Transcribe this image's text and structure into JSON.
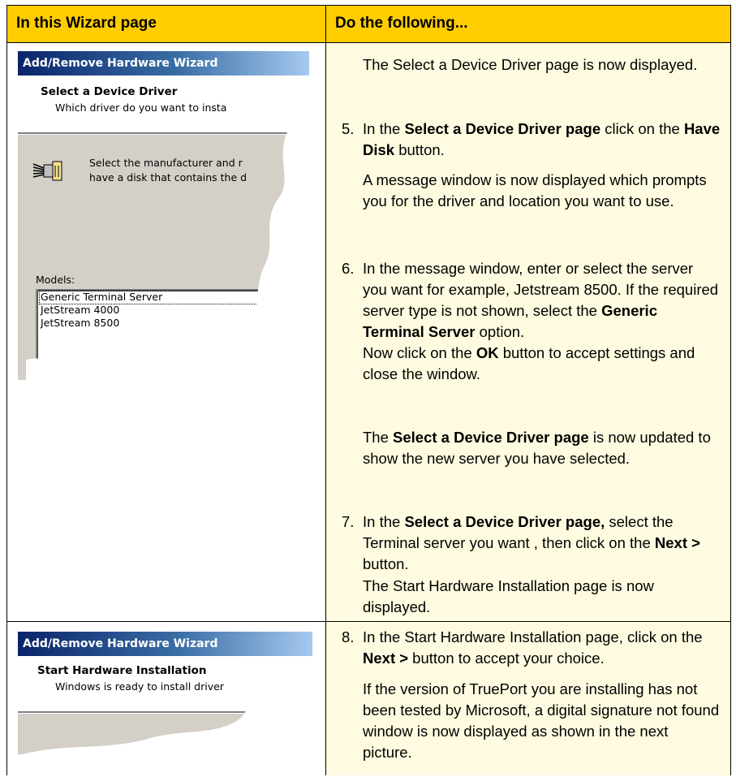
{
  "table": {
    "header_left": "In this Wizard page",
    "header_right": "Do the following...",
    "colors": {
      "header": "#ffcd00",
      "right_cell": "#fffbe0",
      "wizard_title_bar": "#0a246a",
      "dialog_grey": "#d4d0c8"
    }
  },
  "wizard1": {
    "title_bar": "Add/Remove Hardware Wizard",
    "heading": "Select a Device Driver",
    "subheading": "Which driver do you want to insta",
    "instruction_line1": "Select the manufacturer and r",
    "instruction_line2": "have a disk that contains the d",
    "icon": "serial-port-icon",
    "models_label": "Models:",
    "models": [
      "Generic Terminal Server",
      "JetStream 4000",
      "JetStream 8500"
    ]
  },
  "wizard2": {
    "title_bar": "Add/Remove Hardware Wizard",
    "heading": "Start Hardware Installation",
    "subheading": "Windows is ready to install driver"
  },
  "steps": {
    "intro": "The Select a Device Driver page is now displayed.",
    "s5_num": "5.",
    "s5_pre": "In the ",
    "s5_b1": "Select a Device Driver page",
    "s5_mid": " click on the ",
    "s5_b2": "Have Disk",
    "s5_post": " button.",
    "s5_result": "A message window is now displayed which prompts you for the driver and location you want to use.",
    "s6_num": "6.",
    "s6_pre": "In the message window, enter or select the server you want for example, Jetstream 8500. If the required server type is not shown, select the ",
    "s6_b1": "Generic Terminal Server",
    "s6_post": " option.",
    "s6_l2_pre": "Now click on the ",
    "s6_b2": "OK",
    "s6_l2_post": " button to accept settings and close the window.",
    "s6_r_pre": "The ",
    "s6_r_b": "Select a Device Driver page",
    "s6_r_post": " is now updated to show the new server you have selected.",
    "s7_num": "7.",
    "s7_pre": "In the ",
    "s7_b1": "Select a Device Driver page,",
    "s7_mid": " select the Terminal server you want , then click on the ",
    "s7_b2": "Next >",
    "s7_post": " button.",
    "s7_result": "The Start Hardware Installation page is now displayed.",
    "s8_num": "8.",
    "s8_pre": "In the Start Hardware Installation page, click on the ",
    "s8_b1": "Next >",
    "s8_post": " button to accept your choice.",
    "s8_result": "If the version of TruePort you are installing has not been tested by Microsoft, a digital signature not found window is now displayed as shown in the next picture."
  }
}
